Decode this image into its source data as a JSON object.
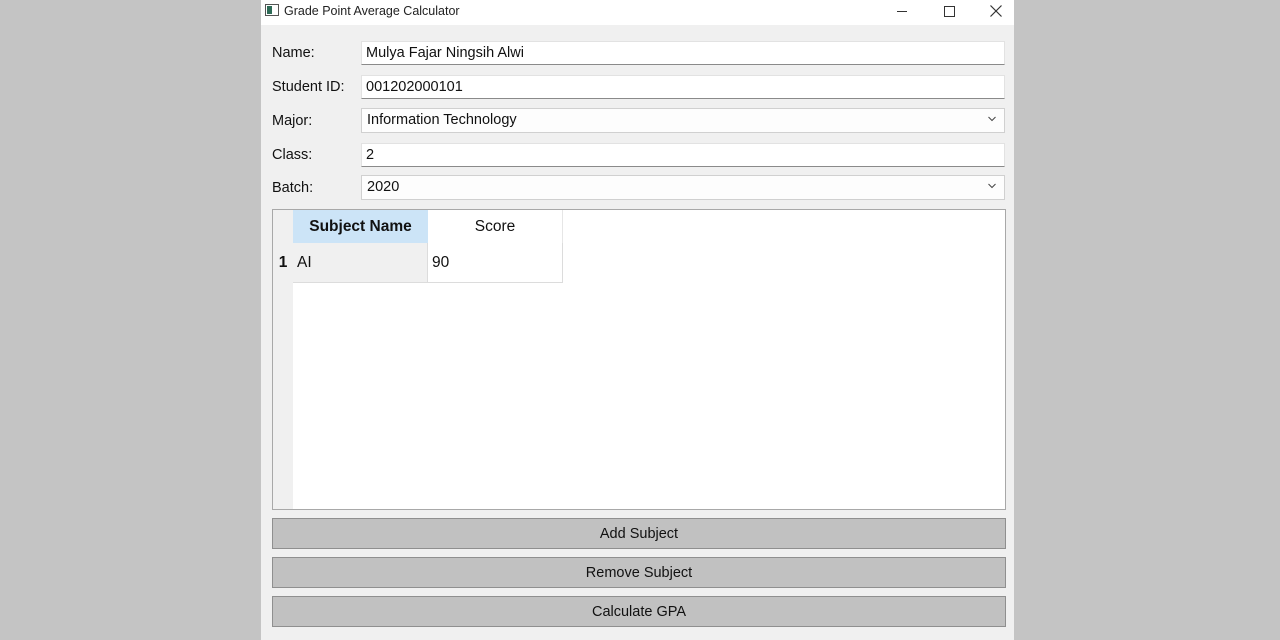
{
  "window": {
    "title": "Grade Point Average Calculator"
  },
  "form": {
    "name_label": "Name:",
    "name_value": "Mulya Fajar Ningsih Alwi",
    "student_id_label": "Student ID:",
    "student_id_value": "001202000101",
    "major_label": "Major:",
    "major_selected": "Information Technology",
    "class_label": "Class:",
    "class_value": "2",
    "batch_label": "Batch:",
    "batch_selected": "2020"
  },
  "table": {
    "columns": [
      "Subject Name",
      "Score"
    ],
    "rows": [
      {
        "row_number": "1",
        "subject": "AI",
        "score": "90"
      }
    ]
  },
  "buttons": {
    "add_subject": "Add Subject",
    "remove_subject": "Remove Subject",
    "calculate_gpa": "Calculate GPA"
  },
  "colors": {
    "selected_header": "#cce4f7",
    "button_bg": "#c1c1c1",
    "window_bg": "#f0f0f0",
    "desktop_bg": "#c4c4c4"
  }
}
